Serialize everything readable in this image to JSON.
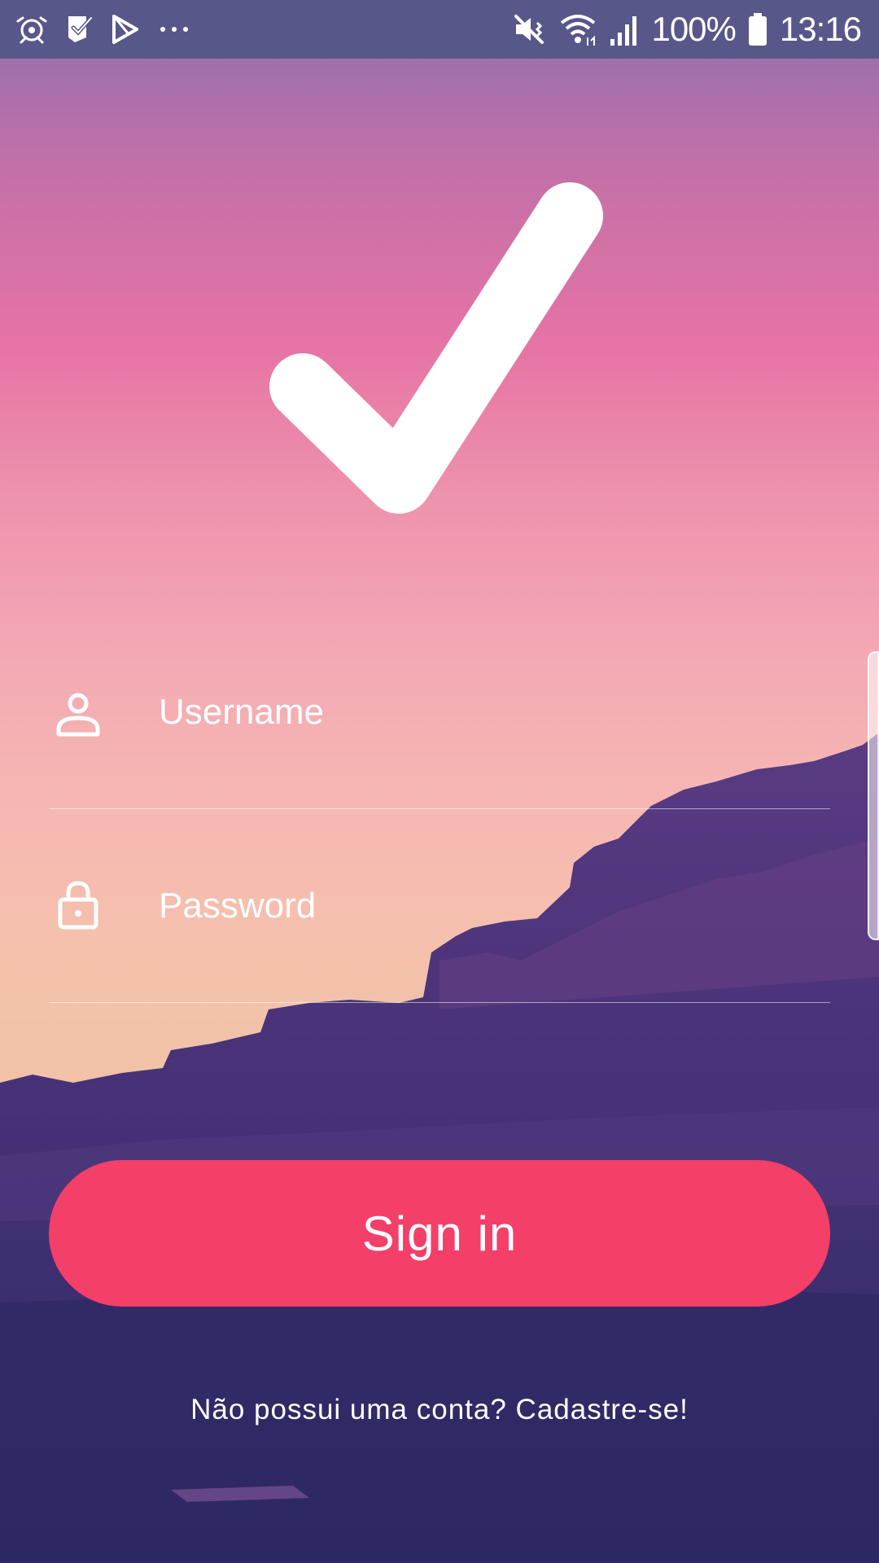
{
  "status_bar": {
    "left_icons": [
      "notification-icon",
      "check-task-icon",
      "play-store-icon",
      "more-dots-icon"
    ],
    "right_icons": [
      "mute-vibrate-icon",
      "wifi-icon",
      "cell-signal-icon",
      "battery-icon"
    ],
    "battery": "100%",
    "time": "13:16"
  },
  "logo": {
    "icon": "checkmark-icon"
  },
  "login_form": {
    "username": {
      "icon": "user-icon",
      "placeholder": "Username",
      "value": ""
    },
    "password": {
      "icon": "lock-icon",
      "placeholder": "Password",
      "value": ""
    }
  },
  "actions": {
    "sign_in_label": "Sign in",
    "signup_text": "Não possui uma conta? Cadastre-se!"
  },
  "colors": {
    "status_bar": "#58578a",
    "accent_button": "#f43f69",
    "landscape": "#3d2a6b"
  }
}
